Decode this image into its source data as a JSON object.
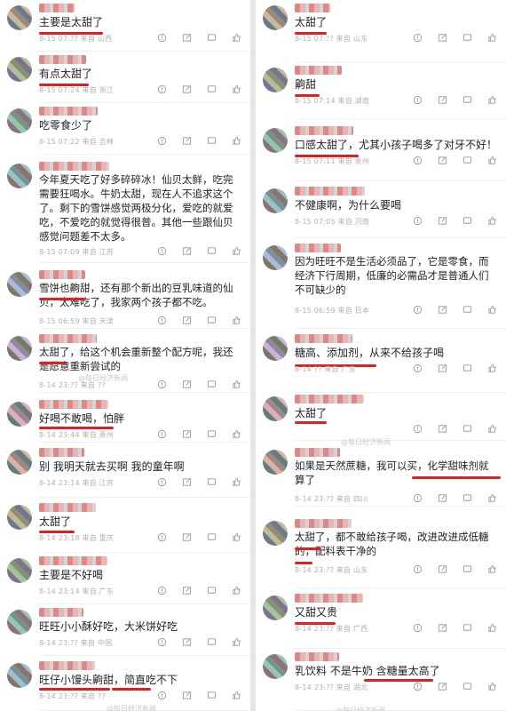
{
  "left": [
    {
      "text": "主要是太甜了",
      "meta": "8-15 07:?? 来自 山西"
    },
    {
      "text": "有点太甜了",
      "meta": "8-15 07:24 来自 浙江"
    },
    {
      "text": "吃零食少了",
      "meta": "8-15 07:22 来自 吉林"
    },
    {
      "text": "今年夏天吃了好多碎碎冰！仙贝太鲜，吃完需要狂喝水。牛奶太甜，现在人不追求这个了。剩下的雪饼感觉两极分化，爱吃的就爱吃，不爱吃的就觉得很普。其他一些跟仙贝感觉问题差不太多。",
      "meta": "8-15 07:09 来自 江苏"
    },
    {
      "text": "雪饼也齁甜，还有那个新出的豆乳味道的仙贝，太难吃了，我家两个孩子都不吃。",
      "meta": "8-15 06:59 来自 天津"
    },
    {
      "text": "太甜了，给这个机会重新整个配方呢，我还是愿意重新尝试的",
      "meta": "8-14 23:?? 来自 ??"
    },
    {
      "text": "好喝不敢喝，怕胖",
      "meta": "8-14 23:44 来自 贵州"
    },
    {
      "text": "别 我明天就去买啊 我的童年啊",
      "meta": "8-14 23:14 来自 江苏"
    },
    {
      "text": "太甜了",
      "meta": "8-14 23:18 来自 重庆"
    },
    {
      "text": "主要是不好喝",
      "meta": "8-14 23:14 来自 广东"
    },
    {
      "text": "旺旺小小酥好吃，大米饼好吃",
      "meta": "8-14 23:?? 来自 中国"
    },
    {
      "text": "旺仔小馒头齁甜，简直吃不下",
      "meta": "8-14 23:?? 来自 ??"
    }
  ],
  "right": [
    {
      "text": "太甜了",
      "meta": "8-15 07:?? 来自 山东"
    },
    {
      "text": "齁甜",
      "meta": "8-15 07:14 来自 湖南"
    },
    {
      "text": "口感太甜了，尤其小孩子喝多了对牙不好！",
      "meta": "8-15 07:11 来自 贵州"
    },
    {
      "text": "不健康啊，为什么要喝",
      "meta": "8-15 07:05 来自 河南"
    },
    {
      "text": "因为旺旺不是生活必须品了，它是零食，而经济下行周期，低廉的必需品才是普通人们不可缺少的",
      "meta": "8-15 06:59 来自 日本"
    },
    {
      "text": "糖高、添加剂，从来不给孩子喝",
      "meta": "8-14 ?? 来自 广东"
    },
    {
      "text": "太甜了",
      "meta": ""
    },
    {
      "text": "如果是天然蔗糖，我可以买，化学甜味剂就算了",
      "meta": "8-14 23:?? 来自 四川"
    },
    {
      "text": "太甜了，都不敢给孩子喝，改进改进成低糖的，配料表干净的",
      "meta": "8-14 23:?? 来自 山东"
    },
    {
      "text": "又甜又贵",
      "meta": "8-14 23:?? 来自 广西"
    },
    {
      "text": "乳饮料 不是牛奶 含糖量太高了",
      "meta": "8-14 23:?? 来自 湖北"
    }
  ],
  "watermarks": [
    "@每日经济新闻",
    "@每日经济新闻",
    "@每日经济新闻",
    "@每日经济新闻"
  ]
}
